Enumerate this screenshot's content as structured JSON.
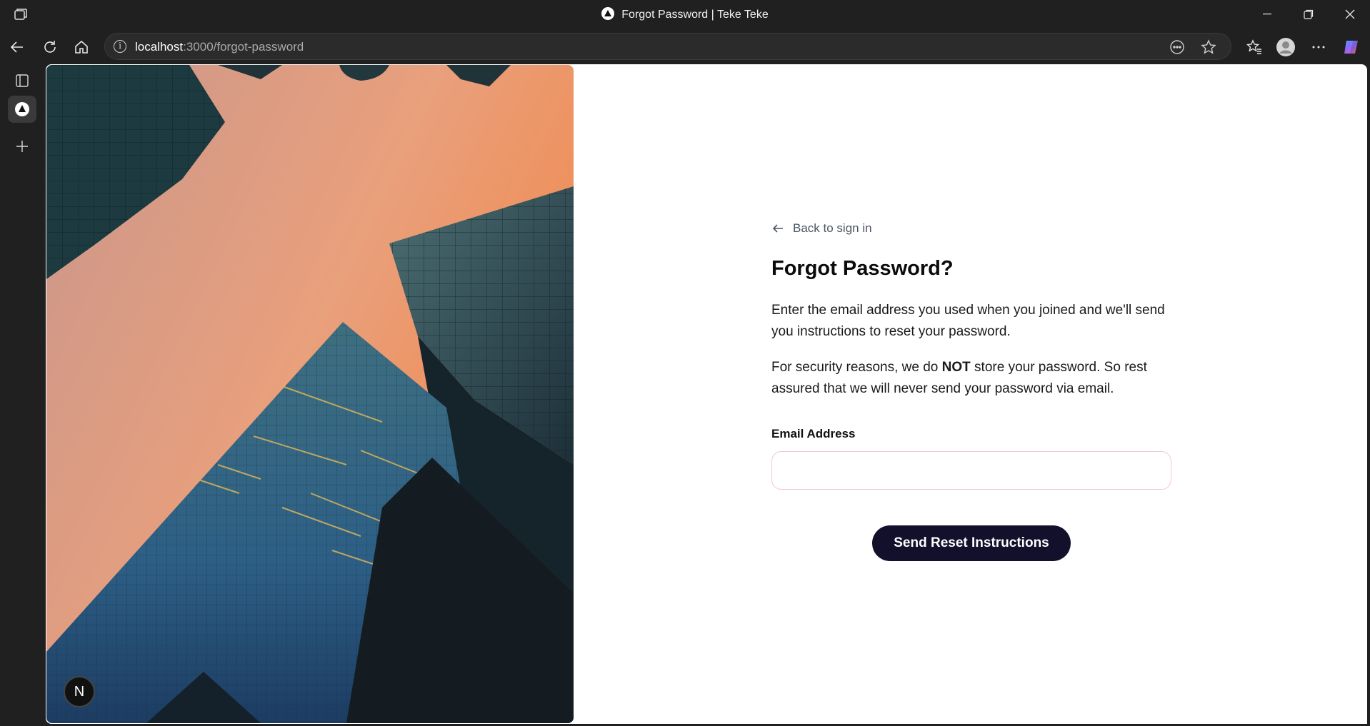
{
  "window": {
    "title": "Forgot Password | Teke Teke"
  },
  "address_bar": {
    "host": "localhost",
    "path": ":3000/forgot-password"
  },
  "page": {
    "back_link": "Back to sign in",
    "heading": "Forgot Password?",
    "para1": "Enter the email address you used when you joined and we'll send you instructions to reset your password.",
    "para2_before": "For security reasons, we do ",
    "para2_bold": "NOT",
    "para2_after": " store your password. So rest assured that we will never send your password via email.",
    "email_label": "Email Address",
    "email_value": "",
    "submit_label": "Send Reset Instructions",
    "badge_letter": "N"
  },
  "colors": {
    "submit_bg": "#12102a",
    "input_border": "#f2c4dc",
    "chrome_bg": "#202020"
  }
}
